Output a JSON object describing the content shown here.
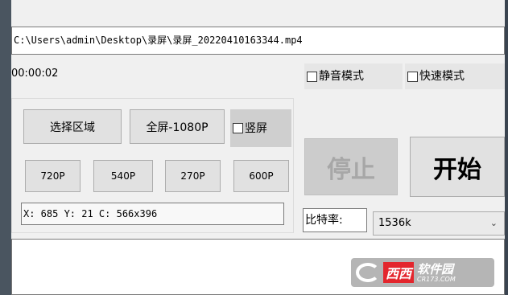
{
  "path": {
    "value": "C:\\Users\\admin\\Desktop\\录屏\\录屏_20220410163344.mp4"
  },
  "elapsed": "00:00:02",
  "options": {
    "mute_label": "静音模式",
    "fast_label": "快速模式",
    "vertical_label": "竖屏"
  },
  "capture": {
    "region_label": "选择区域",
    "fullscreen_label": "全屏-1080P"
  },
  "presets": [
    "720P",
    "540P",
    "270P",
    "600P"
  ],
  "coords": "X: 685 Y: 21 C: 566x396",
  "controls": {
    "stop_label": "停止",
    "start_label": "开始"
  },
  "bitrate": {
    "label": "比特率:",
    "selected": "1536k"
  },
  "watermark": {
    "brand": "西西",
    "cn": "软件园",
    "en": "CR173.COM"
  }
}
